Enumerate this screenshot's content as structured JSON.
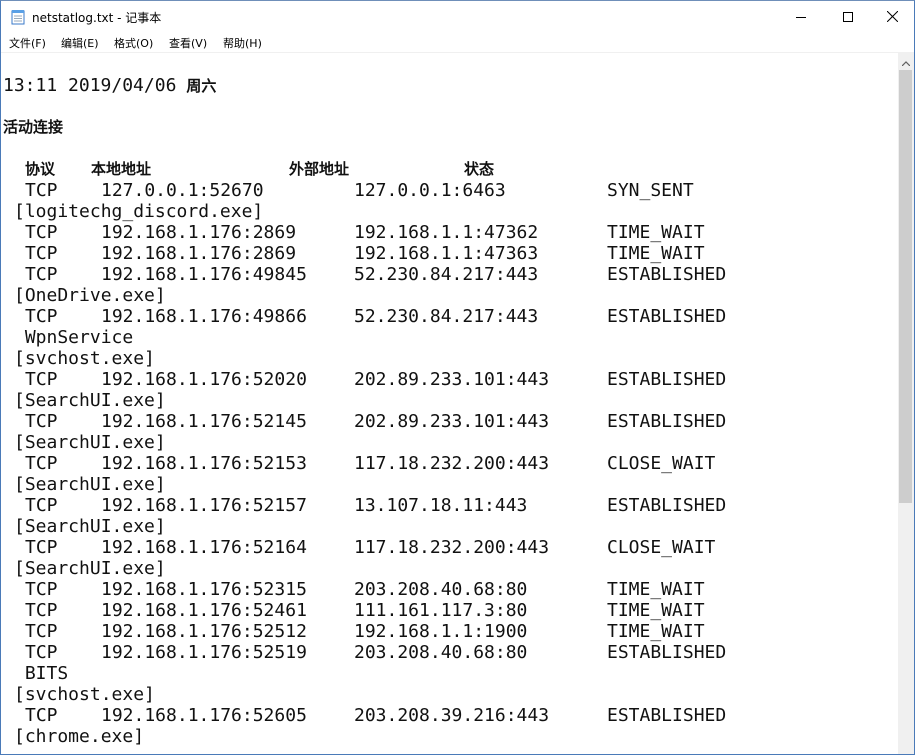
{
  "window": {
    "title": "netstatlog.txt - 记事本",
    "controls": {
      "minimize": "minimize-icon",
      "maximize": "maximize-icon",
      "close": "close-icon"
    }
  },
  "menu": [
    "文件(F)",
    "编辑(E)",
    "格式(O)",
    "查看(V)",
    "帮助(H)"
  ],
  "doc": {
    "date": "2019/04/06",
    "weekday": "周六",
    "time": "13:11",
    "heading": "活动连接",
    "columns": [
      "协议",
      "本地地址",
      "外部地址",
      "状态"
    ],
    "rows": [
      [
        "TCP",
        "127.0.0.1:52670",
        "127.0.0.1:6463",
        "SYN_SENT"
      ],
      [
        "[logitechg_discord.exe]"
      ],
      [
        "TCP",
        "192.168.1.176:2869",
        "192.168.1.1:47362",
        "TIME_WAIT"
      ],
      [
        "TCP",
        "192.168.1.176:2869",
        "192.168.1.1:47363",
        "TIME_WAIT"
      ],
      [
        "TCP",
        "192.168.1.176:49845",
        "52.230.84.217:443",
        "ESTABLISHED"
      ],
      [
        "[OneDrive.exe]"
      ],
      [
        "TCP",
        "192.168.1.176:49866",
        "52.230.84.217:443",
        "ESTABLISHED"
      ],
      [
        " WpnService"
      ],
      [
        "[svchost.exe]"
      ],
      [
        "TCP",
        "192.168.1.176:52020",
        "202.89.233.101:443",
        "ESTABLISHED"
      ],
      [
        "[SearchUI.exe]"
      ],
      [
        "TCP",
        "192.168.1.176:52145",
        "202.89.233.101:443",
        "ESTABLISHED"
      ],
      [
        "[SearchUI.exe]"
      ],
      [
        "TCP",
        "192.168.1.176:52153",
        "117.18.232.200:443",
        "CLOSE_WAIT"
      ],
      [
        "[SearchUI.exe]"
      ],
      [
        "TCP",
        "192.168.1.176:52157",
        "13.107.18.11:443",
        "ESTABLISHED"
      ],
      [
        "[SearchUI.exe]"
      ],
      [
        "TCP",
        "192.168.1.176:52164",
        "117.18.232.200:443",
        "CLOSE_WAIT"
      ],
      [
        "[SearchUI.exe]"
      ],
      [
        "TCP",
        "192.168.1.176:52315",
        "203.208.40.68:80",
        "TIME_WAIT"
      ],
      [
        "TCP",
        "192.168.1.176:52461",
        "111.161.117.3:80",
        "TIME_WAIT"
      ],
      [
        "TCP",
        "192.168.1.176:52512",
        "192.168.1.1:1900",
        "TIME_WAIT"
      ],
      [
        "TCP",
        "192.168.1.176:52519",
        "203.208.40.68:80",
        "ESTABLISHED"
      ],
      [
        " BITS"
      ],
      [
        "[svchost.exe]"
      ],
      [
        "TCP",
        "192.168.1.176:52605",
        "203.208.39.216:443",
        "ESTABLISHED"
      ],
      [
        "[chrome.exe]"
      ]
    ]
  }
}
